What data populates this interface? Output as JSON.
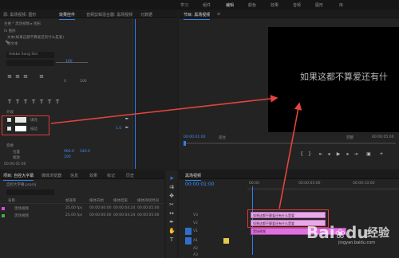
{
  "top_bar": {
    "left_tabs": [
      "学习",
      "组件",
      "编辑",
      "颜色",
      "效果",
      "音频",
      "图形",
      "库"
    ]
  },
  "effect_controls": {
    "tabs": [
      "源: 黑场视频: 图形",
      "效果控件",
      "音频剪辑混合器: 黑场视频",
      "元数据"
    ],
    "sub_header": "主要 * 黑场视频 ▸ 图形",
    "fx_row": "fx 图形",
    "text_item": "文本(如果这都不算爱还有什么是爱)",
    "layer_label": "源文本",
    "font_name": "Adobe Song Std",
    "appearance_label": "外观",
    "fill_label": "填充",
    "stroke_label": "描边",
    "transform_label": "变换",
    "position_label": "位置",
    "position_values": [
      "960.0",
      "540.0"
    ],
    "scale_label": "缩放",
    "value_100": "100",
    "small_values": [
      "0",
      "100"
    ],
    "timecode": "00:00:01:00"
  },
  "program_monitor": {
    "title": "节目: 黑场视频",
    "menu_icon": "≡",
    "overlay_text": "如果这都不算爱还有什",
    "timecode_left": "00:00:01:00",
    "fit_label": "适合",
    "full_label": "完整",
    "timecode_right": "00:00:05:00"
  },
  "project_panel": {
    "tabs": [
      "项目: 自控大字幕",
      "媒体浏览器",
      "信息",
      "效果",
      "标记",
      "历史"
    ],
    "project_name": "自控大字幕.prproj",
    "search_placeholder": "",
    "columns": [
      "名称",
      "帧速率",
      "媒体开始",
      "媒体结束",
      "媒体持续时间"
    ],
    "items": [
      {
        "name": "黑场视频",
        "fps": "25.00 fps",
        "start": "00:00:00:00",
        "end": "00:00:04:24",
        "dur": "00:00:05:00",
        "color": "#d94bd9"
      },
      {
        "name": "黑场视频",
        "fps": "25.00 fps",
        "start": "00:00:00:00",
        "end": "00:00:04:24",
        "dur": "00:00:05:00",
        "color": "#3fae4a"
      }
    ]
  },
  "timeline": {
    "title": "黑场视频",
    "timecode": "00:00:01:00",
    "ruler": [
      "00:00",
      "00:00:05:00",
      "00:00:10:00"
    ],
    "tracks": [
      "V3",
      "V2",
      "V1",
      "A1",
      "A2",
      "A3"
    ],
    "clips": [
      {
        "label": "如果这都不算爱还有什么是爱",
        "color": "#e8a9e8"
      },
      {
        "label": "如果这都不算爱还有什么是爱",
        "color": "#e8a9e8"
      },
      {
        "label": "黑场视频",
        "color": "#e070e0"
      }
    ]
  },
  "watermark": {
    "brand": "Bai",
    "sub": "du",
    "text": "经验",
    "url": "jingyan.baidu.com"
  },
  "colors": {
    "accent": "#2f80ed",
    "highlight_box": "#e23a3a",
    "arrow": "#e5433d"
  }
}
